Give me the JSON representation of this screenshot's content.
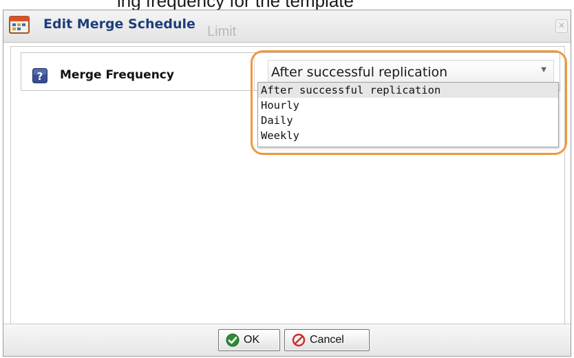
{
  "background": {
    "top_text": "ing frequency for the template",
    "behind_title_text": "Limit"
  },
  "dialog": {
    "title": "Edit Merge Schedule",
    "close_glyph": "×",
    "title_icon": "schedule-window-icon"
  },
  "property": {
    "label": "Merge Frequency",
    "help_icon": "help-question-icon",
    "selected_value": "After successful replication"
  },
  "dropdown": {
    "options": [
      "After successful replication",
      "Hourly",
      "Daily",
      "Weekly"
    ],
    "selected_index": 0
  },
  "footer": {
    "ok_label": "OK",
    "cancel_label": "Cancel"
  },
  "colors": {
    "title": "#1c3f7a",
    "highlight": "#f0973a",
    "ok_icon": "#2e8b3a",
    "cancel_icon": "#cc2b2b"
  }
}
